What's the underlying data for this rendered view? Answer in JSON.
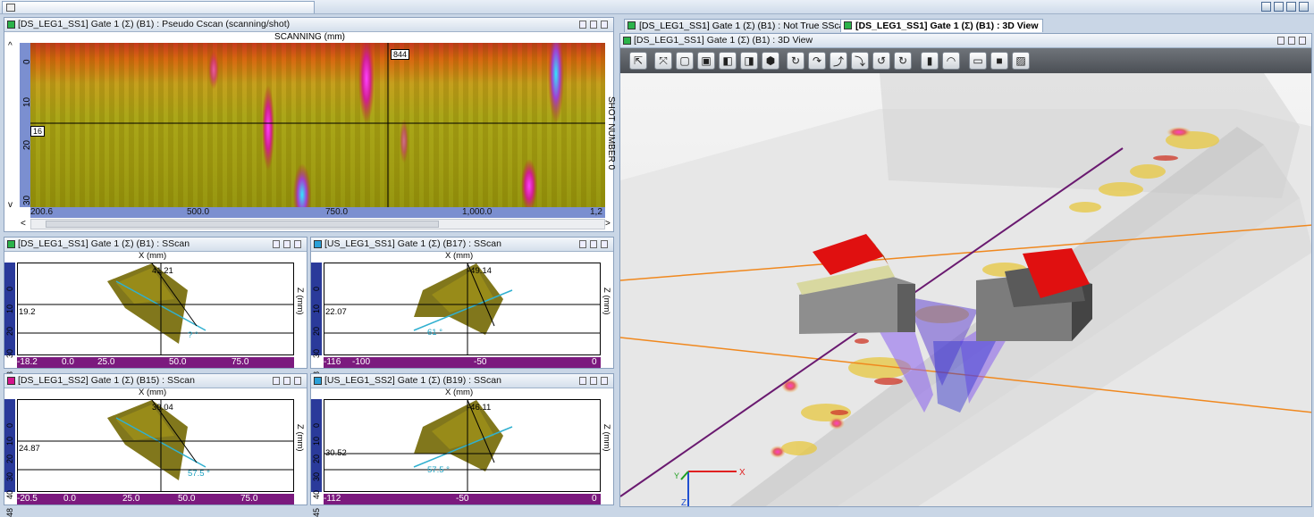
{
  "colors": {
    "gate_green": "#2bb34a",
    "gate_magenta": "#d4148c",
    "gate_cyan": "#2aa0d8",
    "ruler_purple": "#7b1a7e"
  },
  "cscan": {
    "title": "[DS_LEG1_SS1] Gate 1 (Σ) (B1) : Pseudo Cscan (scanning/shot)",
    "x_axis_label": "SCANNING (mm)",
    "y_axis_label": "SHOT NUMBER 0",
    "cursor_x_value": "844",
    "cursor_y_value": "16",
    "x_ticks": [
      "200.6",
      "500.0",
      "750.0",
      "1,000.0",
      "1,2"
    ],
    "y_ticks": [
      "0",
      "10",
      "20",
      "30"
    ]
  },
  "sscans": [
    {
      "title": "[DS_LEG1_SS1] Gate 1 (Σ) (B1) : SScan",
      "indicator": "green",
      "x_label": "X (mm)",
      "z_label": "Z (mm)",
      "x_value": "41.21",
      "z_value": "19.2",
      "angle": "? °",
      "h_ticks": [
        "-18.2",
        "0.0",
        "25.0",
        "50.0",
        "75.0",
        "10"
      ],
      "v_ticks": [
        "0",
        "10",
        "20",
        "30",
        "43"
      ]
    },
    {
      "title": "[US_LEG1_SS1] Gate 1 (Σ) (B17) : SScan",
      "indicator": "cyan",
      "x_label": "X (mm)",
      "z_label": "Z (mm)",
      "x_value": "-49.14",
      "z_value": "22.07",
      "angle": "61 °",
      "h_ticks": [
        "-116",
        "-100",
        "-50",
        "0",
        "1"
      ],
      "v_ticks": [
        "0",
        "10",
        "20",
        "30",
        "48"
      ]
    },
    {
      "title": "[DS_LEG1_SS2] Gate 1 (Σ) (B15) : SScan",
      "indicator": "magenta",
      "x_label": "X (mm)",
      "z_label": "Z (mm)",
      "x_value": "39.04",
      "z_value": "24.87",
      "angle": "57.5 °",
      "h_ticks": [
        "-20.5",
        "0.0",
        "25.0",
        "50.0",
        "75.0",
        "10"
      ],
      "v_ticks": [
        "0",
        "10",
        "20",
        "30",
        "40",
        "48"
      ]
    },
    {
      "title": "[US_LEG1_SS2] Gate 1 (Σ) (B19) : SScan",
      "indicator": "cyan",
      "x_label": "X (mm)",
      "z_label": "Z (mm)",
      "x_value": "-46.11",
      "z_value": "30.52",
      "angle": "57.5 °",
      "h_ticks": [
        "-112",
        "-50",
        "0",
        "1"
      ],
      "v_ticks": [
        "0",
        "10",
        "20",
        "30",
        "40",
        "45"
      ]
    }
  ],
  "view3d": {
    "tabs": [
      {
        "label": "[DS_LEG1_SS1] Gate 1 (Σ) (B1) : Not True SScan",
        "active": false
      },
      {
        "label": "[DS_LEG1_SS1] Gate 1 (Σ) (B1) : 3D View",
        "active": true
      }
    ],
    "title": "[DS_LEG1_SS1] Gate 1 (Σ) (B1) : 3D View",
    "toolbar": [
      "select-tool-icon",
      "fit-view-icon",
      "view-front-icon",
      "view-back-icon",
      "view-left-icon",
      "view-right-icon",
      "view-iso-icon",
      "rotate-left-icon",
      "rotate-right-icon",
      "rotate-up-icon",
      "rotate-down-icon",
      "rotate-ccw-icon",
      "rotate-cw-icon",
      "cut-plane-icon",
      "shade-icon",
      "wireframe-icon",
      "solid-icon",
      "hatch-icon"
    ],
    "axes": {
      "x": "X",
      "y": "Y",
      "z": "Z"
    }
  }
}
